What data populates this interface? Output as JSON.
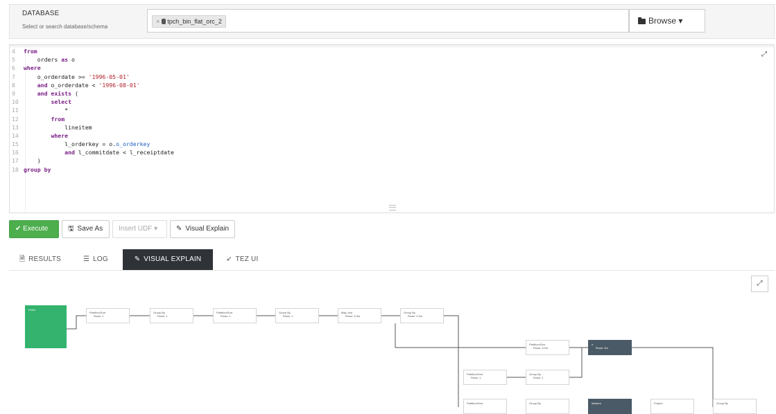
{
  "database": {
    "label": "DATABASE",
    "hint": "Select or search database/schema",
    "selected": "tpch_bin_flat_orc_2",
    "remove_glyph": "×",
    "browse_label": "Browse ▾"
  },
  "editor": {
    "expand_glyph": "⤢",
    "lines": [
      {
        "n": "4",
        "tokens": [
          {
            "t": "from",
            "k": "kw"
          }
        ]
      },
      {
        "n": "5",
        "tokens": [
          {
            "t": "    orders ",
            "k": "id"
          },
          {
            "t": "as",
            "k": "kw"
          },
          {
            "t": " o",
            "k": "id"
          }
        ]
      },
      {
        "n": "6",
        "tokens": [
          {
            "t": "where",
            "k": "kw"
          }
        ]
      },
      {
        "n": "7",
        "tokens": [
          {
            "t": "    o_orderdate >= ",
            "k": "id"
          },
          {
            "t": "'1996-05-01'",
            "k": "str"
          }
        ]
      },
      {
        "n": "8",
        "tokens": [
          {
            "t": "    ",
            "k": "id"
          },
          {
            "t": "and",
            "k": "kw"
          },
          {
            "t": " o_orderdate < ",
            "k": "id"
          },
          {
            "t": "'1996-08-01'",
            "k": "str"
          }
        ]
      },
      {
        "n": "9",
        "tokens": [
          {
            "t": "    ",
            "k": "id"
          },
          {
            "t": "and exists",
            "k": "kw"
          },
          {
            "t": " (",
            "k": "id"
          }
        ]
      },
      {
        "n": "10",
        "tokens": [
          {
            "t": "        ",
            "k": "id"
          },
          {
            "t": "select",
            "k": "kw"
          }
        ]
      },
      {
        "n": "11",
        "tokens": [
          {
            "t": "            *",
            "k": "id"
          }
        ]
      },
      {
        "n": "12",
        "tokens": [
          {
            "t": "        ",
            "k": "id"
          },
          {
            "t": "from",
            "k": "kw"
          }
        ]
      },
      {
        "n": "13",
        "tokens": [
          {
            "t": "            lineitem",
            "k": "id"
          }
        ]
      },
      {
        "n": "14",
        "tokens": [
          {
            "t": "        ",
            "k": "id"
          },
          {
            "t": "where",
            "k": "kw"
          }
        ]
      },
      {
        "n": "15",
        "tokens": [
          {
            "t": "            l_orderkey = o.",
            "k": "id"
          },
          {
            "t": "o_orderkey",
            "k": "var"
          }
        ]
      },
      {
        "n": "16",
        "tokens": [
          {
            "t": "            ",
            "k": "id"
          },
          {
            "t": "and",
            "k": "kw"
          },
          {
            "t": " l_commitdate < l_receiptdate",
            "k": "id"
          }
        ]
      },
      {
        "n": "17",
        "tokens": [
          {
            "t": "    )",
            "k": "id"
          }
        ]
      },
      {
        "n": "18",
        "tokens": [
          {
            "t": "group by",
            "k": "kw"
          }
        ]
      }
    ]
  },
  "toolbar": {
    "execute": "✔ Execute",
    "save_as": "Save As",
    "insert_udf": "Insert UDF ▾",
    "visual_explain": "Visual Explain"
  },
  "tabs": {
    "results": "RESULTS",
    "log": "LOG",
    "visual_explain": "VISUAL EXPLAIN",
    "tez_ui": "TEZ UI"
  },
  "graph": {
    "expand_glyph": "⤢",
    "nodes": [
      {
        "id": "fetch",
        "title": "Fetch",
        "sub": "",
        "style": "green"
      },
      {
        "id": "n1",
        "title": "Partition/Sort",
        "sub": "Rows: 1"
      },
      {
        "id": "n2",
        "title": "Group By",
        "sub": "Rows: 1"
      },
      {
        "id": "n3",
        "title": "Partition/Sort",
        "sub": "Rows: 1"
      },
      {
        "id": "n4",
        "title": "Group By",
        "sub": "Rows: 1"
      },
      {
        "id": "n5",
        "title": "Map Join",
        "sub": "Rows: 3.3m"
      },
      {
        "id": "n6",
        "title": "Group By",
        "sub": "Rows: 3.3m"
      },
      {
        "id": "n7",
        "title": "Partition/Sort",
        "sub": "Rows: 3.0m"
      },
      {
        "id": "n8",
        "title": "o",
        "sub": "Rows: 3m",
        "style": "dark"
      },
      {
        "id": "n9",
        "title": "Partition/Sort",
        "sub": "Rows: 1"
      },
      {
        "id": "n10",
        "title": "Group By",
        "sub": "Rows: 1"
      },
      {
        "id": "n11",
        "title": "Partition/Sort",
        "sub": ""
      },
      {
        "id": "n12",
        "title": "Group By",
        "sub": ""
      },
      {
        "id": "n13",
        "title": "lineitem",
        "sub": "",
        "style": "dark"
      },
      {
        "id": "n14",
        "title": "Project",
        "sub": ""
      },
      {
        "id": "n15",
        "title": "Group By",
        "sub": ""
      }
    ]
  }
}
